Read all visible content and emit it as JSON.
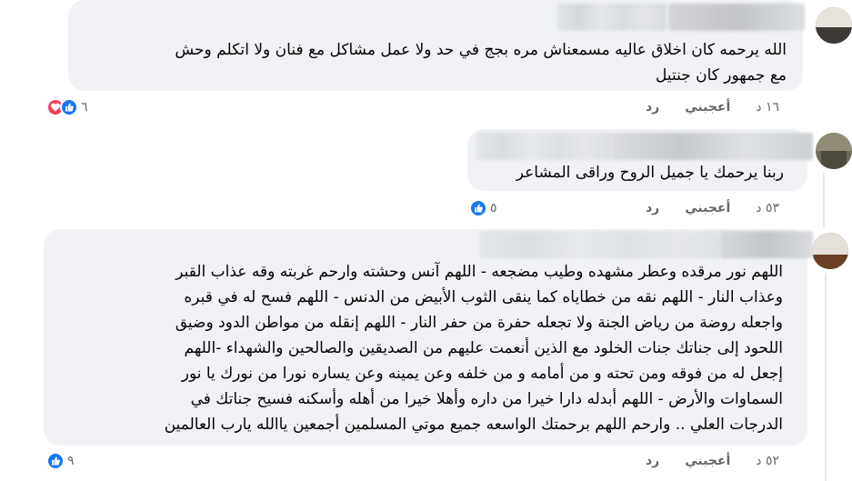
{
  "comments": [
    {
      "text_line1": "الله يرحمه كان اخلاق عاليه مسمعناش مره بجج في حد ولا عمل مشاكل مع فنان ولا اتكلم وحش",
      "text_line2": "مع جمهور كان جنتيل",
      "time": "١٦ د",
      "like_label": "أعجبني",
      "reply_label": "رد",
      "reactions": [
        "heart-icon",
        "like-icon"
      ],
      "reaction_count": "٦"
    },
    {
      "text_line1": "ربنا يرحمك يا جميل الروح وراقى المشاعر",
      "time": "٥٣ د",
      "like_label": "أعجبني",
      "reply_label": "رد",
      "reactions": [
        "like-icon"
      ],
      "reaction_count": "٥"
    },
    {
      "lines": [
        "اللهم نور مرقده وعطر مشهده وطيب مضجعه - اللهم آنس وحشته وارحم غربته وقه عذاب القبر",
        "وعذاب النار - اللهم نقه من خطاياه كما ينقى الثوب الأبيض من الدنس - اللهم فسح له في قبره",
        "واجعله روضة من رياض الجنة ولا تجعله حفرة من حفر النار - اللهم إنقله من مواطن الدود وضيق",
        "اللحود إلى جناتك جنات الخلود مع الذين أنعمت عليهم من الصديقين والصالحين والشهداء -اللهم",
        "إجعل له من فوقه ومن تحته و من أمامه و من خلفه وعن يمينه وعن يساره نورا من نورك يا نور",
        "السماوات والأرض - اللهم أبدله دارا خيرا من داره وأهلا خيرا من أهله وأسكنه فسيح جناتك في",
        "الدرجات العلي .. وارحم اللهم برحمتك الواسعه جميع موتي المسلمين أجمعين ياالله يارب العالمين"
      ],
      "time": "٥٢ د",
      "like_label": "أعجبني",
      "reply_label": "رد",
      "reactions": [
        "like-icon"
      ],
      "reaction_count": "٩"
    }
  ],
  "colors": {
    "bubble": "#f0f2f5",
    "like": "#1877f2",
    "love": "#f33e58",
    "meta": "#65676b"
  }
}
